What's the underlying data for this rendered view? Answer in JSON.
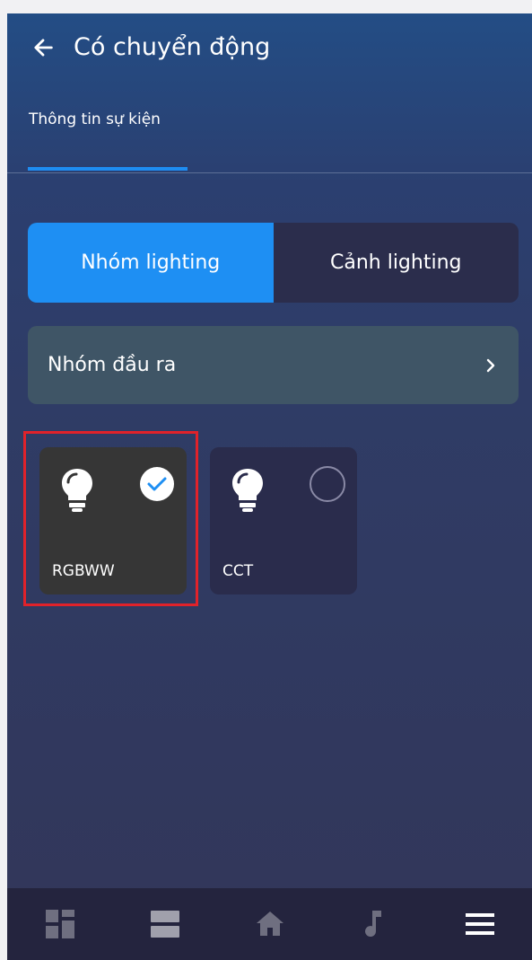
{
  "header": {
    "title": "Có chuyển động",
    "back_icon": "arrow-left-icon"
  },
  "tabs": [
    {
      "label": "Thông tin sự kiện",
      "active": true
    }
  ],
  "segmented": {
    "options": [
      {
        "label": "Nhóm lighting",
        "active": true
      },
      {
        "label": "Cảnh lighting",
        "active": false
      }
    ]
  },
  "output_group": {
    "label": "Nhóm đầu ra",
    "icon": "chevron-right-icon"
  },
  "cards": [
    {
      "name": "RGBWW",
      "icon": "lightbulb-icon",
      "selected": true
    },
    {
      "name": "CCT",
      "icon": "lightbulb-icon",
      "selected": false
    }
  ],
  "bottom_nav": [
    {
      "icon": "dashboard-icon"
    },
    {
      "icon": "list-icon"
    },
    {
      "icon": "home-icon"
    },
    {
      "icon": "music-note-icon"
    },
    {
      "icon": "menu-icon"
    }
  ],
  "colors": {
    "accent": "#1e8ff3",
    "highlight": "#e0222a"
  }
}
